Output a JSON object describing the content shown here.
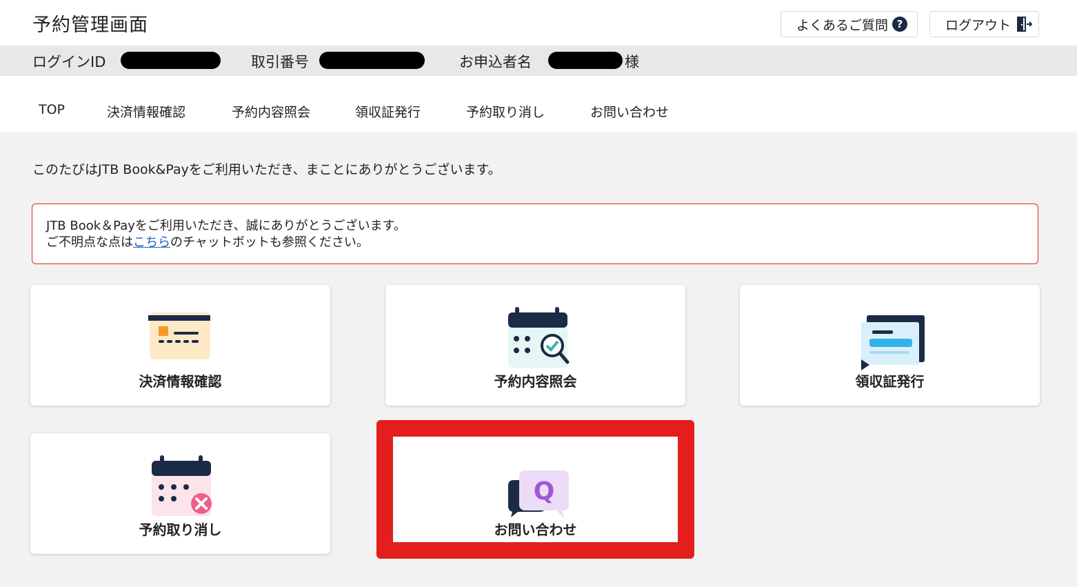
{
  "header": {
    "title": "予約管理画面",
    "faq_label": "よくあるご質問",
    "logout_label": "ログアウト"
  },
  "info": {
    "login_id_label": "ログインID",
    "transaction_label": "取引番号",
    "applicant_label": "お申込者名",
    "applicant_suffix": "様"
  },
  "nav": {
    "items": [
      {
        "label": "TOP"
      },
      {
        "label": "決済情報確認"
      },
      {
        "label": "予約内容照会"
      },
      {
        "label": "領収証発行"
      },
      {
        "label": "予約取り消し"
      },
      {
        "label": "お問い合わせ"
      }
    ]
  },
  "main": {
    "welcome": "このたびはJTB Book&Payをご利用いただき、まことにありがとうございます。",
    "notice": {
      "line1": "JTB Book＆Payをご利用いただき、誠にありがとうございます。",
      "line2_prefix": "ご不明点な点は",
      "line2_link": "こちら",
      "line2_suffix": "のチャットボットも参照ください。"
    },
    "cards": [
      {
        "label": "決済情報確認",
        "icon": "credit-card-icon"
      },
      {
        "label": "予約内容照会",
        "icon": "calendar-search-icon"
      },
      {
        "label": "領収証発行",
        "icon": "receipt-icon"
      },
      {
        "label": "予約取り消し",
        "icon": "calendar-cancel-icon"
      },
      {
        "label": "お問い合わせ",
        "icon": "chat-question-icon"
      }
    ]
  },
  "colors": {
    "accent_red": "#e41d1d",
    "navy": "#1b2a45",
    "link": "#1a63b6"
  }
}
